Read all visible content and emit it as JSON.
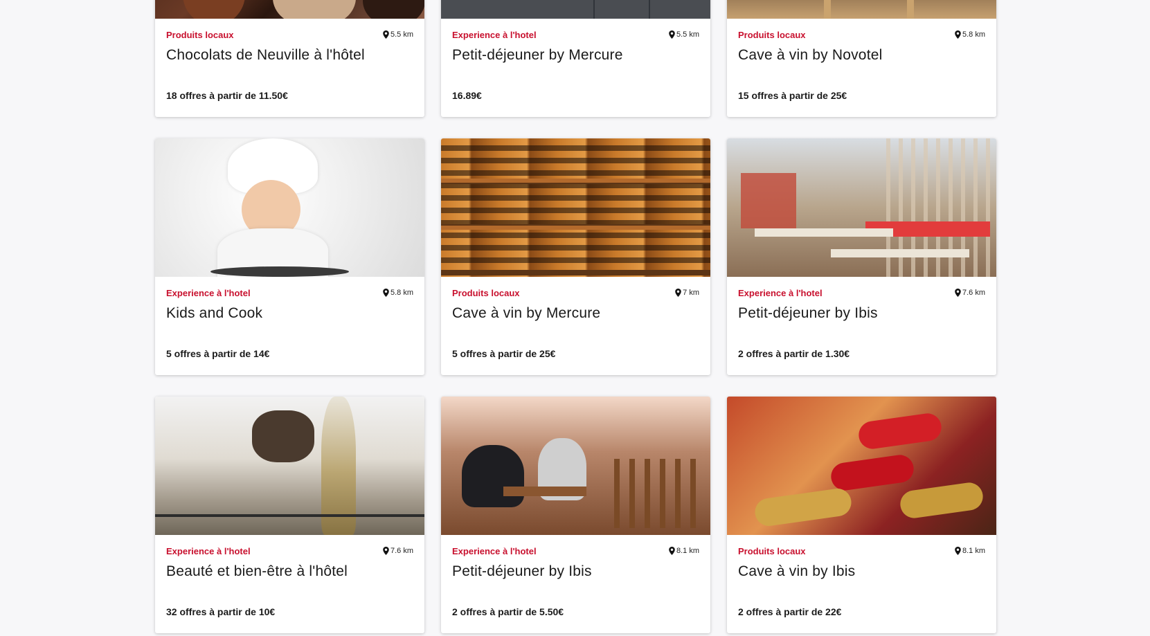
{
  "cards": [
    {
      "category": "Produits locaux",
      "distance": "5.5 km",
      "title": "Chocolats de Neuville à l'hôtel",
      "price": "18 offres à partir de 11.50€",
      "image": "chocolates-photo"
    },
    {
      "category": "Experience à l'hotel",
      "distance": "5.5 km",
      "title": "Petit-déjeuner by Mercure",
      "price": "16.89€",
      "image": "hotel-hall-photo"
    },
    {
      "category": "Produits locaux",
      "distance": "5.8 km",
      "title": "Cave à vin by Novotel",
      "price": "15 offres à partir de 25€",
      "image": "wine-shelf-photo"
    },
    {
      "category": "Experience à l'hotel",
      "distance": "5.8 km",
      "title": "Kids and Cook",
      "price": "5 offres à partir de 14€",
      "image": "child-chef-photo"
    },
    {
      "category": "Produits locaux",
      "distance": "7 km",
      "title": "Cave à vin by Mercure",
      "price": "5 offres à partir de 25€",
      "image": "wine-wall-photo"
    },
    {
      "category": "Experience à l'hotel",
      "distance": "7.6 km",
      "title": "Petit-déjeuner by Ibis",
      "price": "2 offres à partir de 1.30€",
      "image": "restaurant-photo"
    },
    {
      "category": "Experience à l'hotel",
      "distance": "7.6 km",
      "title": "Beauté et bien-être à l'hôtel",
      "price": "32 offres à partir de 10€",
      "image": "spa-photo"
    },
    {
      "category": "Experience à l'hotel",
      "distance": "8.1 km",
      "title": "Petit-déjeuner by Ibis",
      "price": "2 offres à partir de 5.50€",
      "image": "diners-photo"
    },
    {
      "category": "Produits locaux",
      "distance": "8.1 km",
      "title": "Cave à vin by Ibis",
      "price": "2 offres à partir de 22€",
      "image": "wine-bottles-photo"
    }
  ],
  "colors": {
    "category": "#c8102e",
    "background": "#f7f7f9",
    "card": "#ffffff"
  },
  "icons": {
    "distance": "map-pin-icon"
  }
}
